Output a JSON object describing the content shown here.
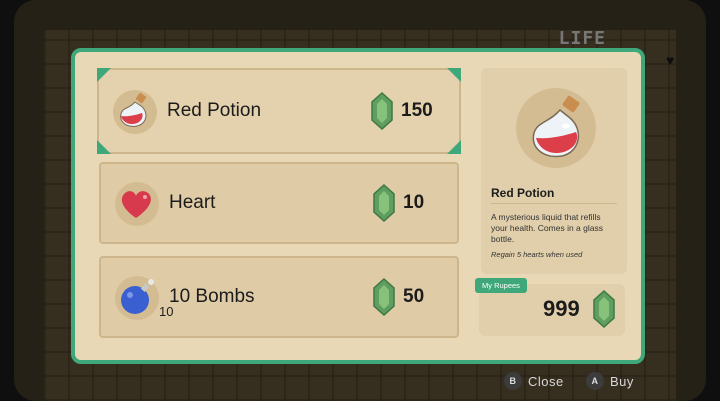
{
  "hud": {
    "life_label": "LIFE"
  },
  "shop": {
    "items": [
      {
        "name": "Red Potion",
        "price": "150",
        "icon": "potion-icon",
        "selected": true
      },
      {
        "name": "Heart",
        "price": "10",
        "icon": "heart-icon",
        "selected": false
      },
      {
        "name": "10 Bombs",
        "price": "50",
        "icon": "bomb-icon",
        "quantity": "10",
        "selected": false
      }
    ]
  },
  "detail": {
    "title": "Red Potion",
    "description": "A mysterious liquid that refills your health. Comes in a glass bottle.",
    "effect": "Regain 5 hearts when used"
  },
  "wallet": {
    "label": "My Rupees",
    "amount": "999"
  },
  "controls": [
    {
      "button": "B",
      "label": "Close"
    },
    {
      "button": "A",
      "label": "Buy"
    }
  ],
  "colors": {
    "accent": "#3fa87a",
    "panel": "#e8d8b5",
    "rupee": "#6cae6a"
  }
}
